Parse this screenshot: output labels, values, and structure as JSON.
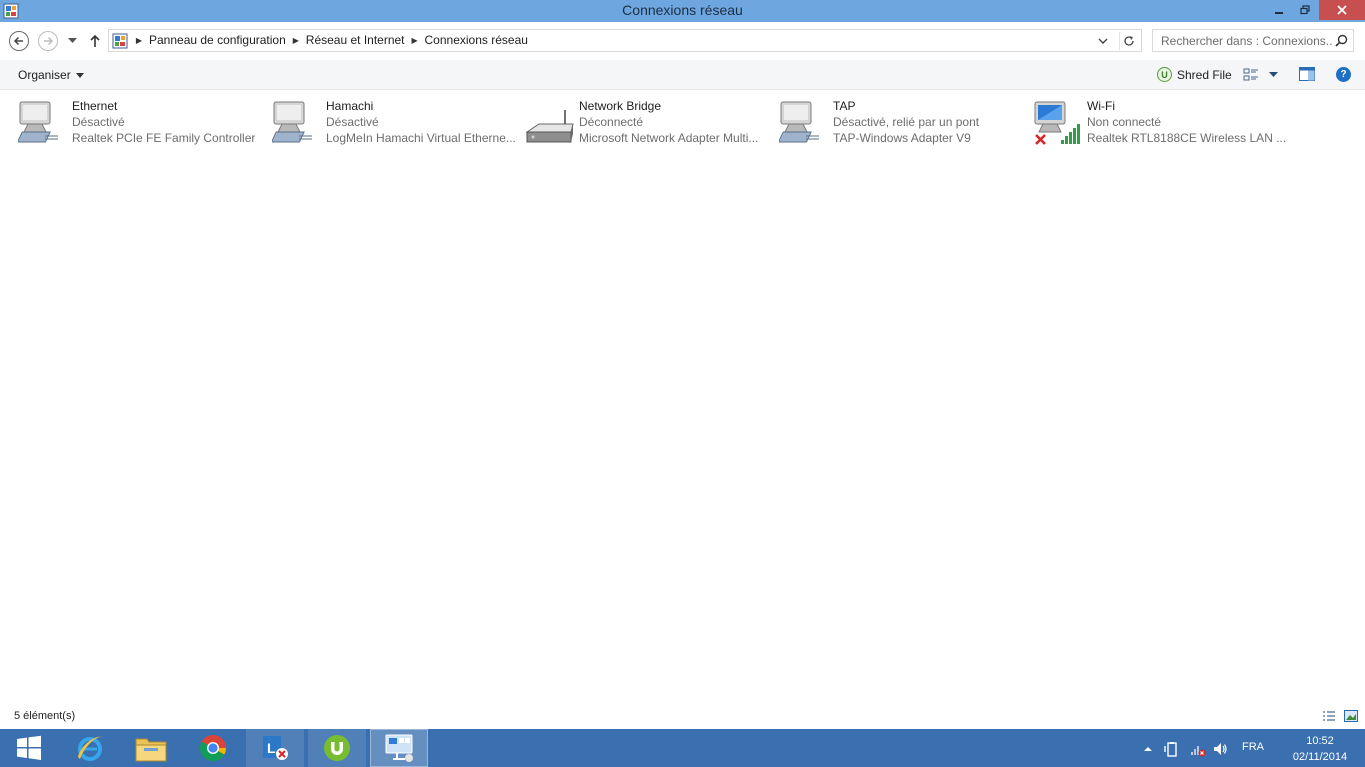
{
  "window": {
    "title": "Connexions réseau"
  },
  "address": {
    "breadcrumbs": [
      "Panneau de configuration",
      "Réseau et Internet",
      "Connexions réseau"
    ]
  },
  "search": {
    "placeholder": "Rechercher dans : Connexions..."
  },
  "toolbar": {
    "organise_label": "Organiser",
    "shred_label": "Shred File",
    "shred_badge": "U",
    "help_label": "?"
  },
  "connections": [
    {
      "name": "Ethernet",
      "status": "Désactivé",
      "device": "Realtek PCIe FE Family Controller",
      "icon": "wired-adapter-icon"
    },
    {
      "name": "Hamachi",
      "status": "Désactivé",
      "device": "LogMeIn Hamachi Virtual Etherne...",
      "icon": "wired-adapter-icon"
    },
    {
      "name": "Network Bridge",
      "status": "Déconnecté",
      "device": "Microsoft Network Adapter Multi...",
      "icon": "network-bridge-icon"
    },
    {
      "name": "TAP",
      "status": "Désactivé, relié par un pont",
      "device": "TAP-Windows Adapter V9",
      "icon": "wired-adapter-icon"
    },
    {
      "name": "Wi-Fi",
      "status": "Non connecté",
      "device": "Realtek RTL8188CE Wireless LAN ...",
      "icon": "wifi-adapter-icon"
    }
  ],
  "statusbar": {
    "count": "5 élément(s)"
  },
  "taskbar": {
    "apps": [
      "start-icon",
      "internet-explorer-icon",
      "file-explorer-icon",
      "chrome-icon",
      "lync-icon",
      "utorrent-icon",
      "network-connections-icon"
    ],
    "language": "FRA",
    "time": "10:52",
    "date": "02/11/2014"
  },
  "colors": {
    "titlebar": "#6ea6df",
    "close_button": "#c74f4f",
    "taskbar": "#3a6fb0",
    "error_red": "#d7262b",
    "signal_green": "#2f9e44"
  }
}
